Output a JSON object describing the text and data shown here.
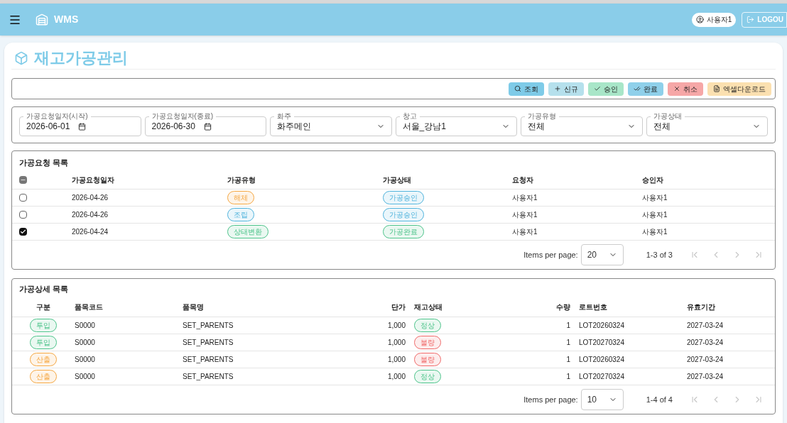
{
  "header": {
    "app_name": "WMS",
    "user": "사용자1",
    "logout": "LOGOU"
  },
  "page": {
    "title": "재고가공관리"
  },
  "toolbar": [
    {
      "kind": "search",
      "label": "조회"
    },
    {
      "kind": "add",
      "label": "신규"
    },
    {
      "kind": "approve",
      "label": "승인"
    },
    {
      "kind": "complete",
      "label": "완료"
    },
    {
      "kind": "cancel",
      "label": "취소"
    },
    {
      "kind": "excel",
      "label": "엑셀다운로드"
    }
  ],
  "filters": [
    {
      "kind": "date",
      "label": "가공요청일자(시작)",
      "value": "2026-06-01"
    },
    {
      "kind": "date",
      "label": "가공요청일자(종료)",
      "value": "2026-06-30"
    },
    {
      "kind": "select",
      "label": "화주",
      "value": "화주메인"
    },
    {
      "kind": "select",
      "label": "창고",
      "value": "서울_강남1"
    },
    {
      "kind": "select",
      "label": "가공유형",
      "value": "전체"
    },
    {
      "kind": "select",
      "label": "가공상태",
      "value": "전체"
    }
  ],
  "requests": {
    "title": "가공요청 목록",
    "select_all_indeterminate": true,
    "columns": [
      "가공요청일자",
      "가공유형",
      "가공상태",
      "요청자",
      "승인자"
    ],
    "rows": [
      {
        "checked": false,
        "date": "2026-04-26",
        "type": {
          "label": "해체",
          "color": "#f5a742"
        },
        "status": {
          "label": "가공승인",
          "color": "#4fb3dc"
        },
        "requester": "사용자1",
        "approver": "사용자1"
      },
      {
        "checked": false,
        "date": "2026-04-26",
        "type": {
          "label": "조립",
          "color": "#4fb3dc"
        },
        "status": {
          "label": "가공승인",
          "color": "#4fb3dc"
        },
        "requester": "사용자1",
        "approver": "사용자1"
      },
      {
        "checked": true,
        "date": "2026-04-24",
        "type": {
          "label": "상태변환",
          "color": "#4cc38a"
        },
        "status": {
          "label": "가공완료",
          "color": "#4cc38a"
        },
        "requester": "사용자1",
        "approver": "사용자1"
      }
    ],
    "pager": {
      "label": "Items per page:",
      "size": "20",
      "range": "1-3 of 3",
      "first_disabled": true,
      "prev_disabled": true,
      "next_disabled": true,
      "last_disabled": true
    }
  },
  "details": {
    "title": "가공상세 목록",
    "columns": [
      "구분",
      "품목코드",
      "품목명",
      "단가",
      "재고상태",
      "수량",
      "로트번호",
      "유효기간"
    ],
    "rows": [
      {
        "kind": {
          "label": "투입",
          "color": "#4cc38a"
        },
        "code": "S0000",
        "name": "SET_PARENTS",
        "price": "1,000",
        "stock": {
          "label": "정상",
          "color": "#4cc38a"
        },
        "qty": "1",
        "lot": "LOT20260324",
        "expiry": "2027-03-24"
      },
      {
        "kind": {
          "label": "투입",
          "color": "#4cc38a"
        },
        "code": "S0000",
        "name": "SET_PARENTS",
        "price": "1,000",
        "stock": {
          "label": "불량",
          "color": "#f06a6a"
        },
        "qty": "1",
        "lot": "LOT20270324",
        "expiry": "2027-03-24"
      },
      {
        "kind": {
          "label": "산출",
          "color": "#f5a742"
        },
        "code": "S0000",
        "name": "SET_PARENTS",
        "price": "1,000",
        "stock": {
          "label": "불량",
          "color": "#f06a6a"
        },
        "qty": "1",
        "lot": "LOT20260324",
        "expiry": "2027-03-24"
      },
      {
        "kind": {
          "label": "산출",
          "color": "#f5a742"
        },
        "code": "S0000",
        "name": "SET_PARENTS",
        "price": "1,000",
        "stock": {
          "label": "정상",
          "color": "#4cc38a"
        },
        "qty": "1",
        "lot": "LOT20270324",
        "expiry": "2027-03-24"
      }
    ],
    "pager": {
      "label": "Items per page:",
      "size": "10",
      "range": "1-4 of 4",
      "first_disabled": true,
      "prev_disabled": true,
      "next_disabled": true,
      "last_disabled": true
    }
  }
}
